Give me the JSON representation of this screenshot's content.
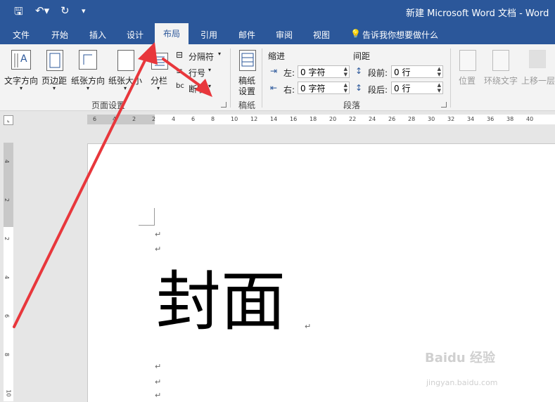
{
  "title_bar": {
    "title": "新建 Microsoft Word 文档  -  Word"
  },
  "tabs": [
    "文件",
    "开始",
    "插入",
    "设计",
    "布局",
    "引用",
    "邮件",
    "审阅",
    "视图"
  ],
  "active_tab": "布局",
  "tell_me": "告诉我你想要做什么",
  "ribbon": {
    "page_setup": {
      "text_direction": "文字方向",
      "margins": "页边距",
      "orientation": "纸张方向",
      "size": "纸张大小",
      "columns": "分栏",
      "breaks": "分隔符",
      "line_numbers": "行号",
      "hyphenation": "断字",
      "group_label": "页面设置"
    },
    "manuscript": {
      "button_line1": "稿纸",
      "button_line2": "设置",
      "group_label": "稿纸"
    },
    "paragraph": {
      "indent_header": "缩进",
      "spacing_header": "间距",
      "left_label": "左:",
      "left_value": "0 字符",
      "right_label": "右:",
      "right_value": "0 字符",
      "before_label": "段前:",
      "before_value": "0 行",
      "after_label": "段后:",
      "after_value": "0 行",
      "group_label": "段落"
    },
    "arrange": {
      "position": "位置",
      "wrap_text": "环绕文字",
      "bring_forward": "上移一层"
    }
  },
  "ruler_ticks": [
    "6",
    "4",
    "2",
    "2",
    "4",
    "6",
    "8",
    "10",
    "12",
    "14",
    "16",
    "18",
    "20",
    "22",
    "24",
    "26",
    "28",
    "30",
    "32",
    "34",
    "36",
    "38",
    "40"
  ],
  "vruler_ticks": [
    "4",
    "2",
    "2",
    "4",
    "6",
    "8",
    "10"
  ],
  "document": {
    "heading": "封面",
    "para_mark": "↵"
  },
  "watermark": {
    "line1": "Baidu 经验",
    "line2": "jingyan.baidu.com"
  },
  "colors": {
    "brand": "#2b579a",
    "arrow": "#e8373c"
  }
}
